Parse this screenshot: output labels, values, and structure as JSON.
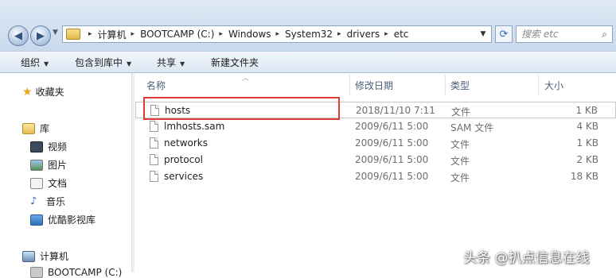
{
  "address": {
    "crumbs": [
      "计算机",
      "BOOTCAMP (C:)",
      "Windows",
      "System32",
      "drivers",
      "etc"
    ]
  },
  "search": {
    "placeholder": "搜索 etc"
  },
  "toolbar": {
    "organize": "组织",
    "include": "包含到库中",
    "share": "共享",
    "new_folder": "新建文件夹"
  },
  "nav": {
    "favorites": "收藏夹",
    "libraries": "库",
    "videos": "视频",
    "pictures": "图片",
    "documents": "文档",
    "music": "音乐",
    "youku": "优酷影视库",
    "computer": "计算机",
    "drive": "BOOTCAMP (C:)"
  },
  "columns": {
    "name": "名称",
    "date": "修改日期",
    "type": "类型",
    "size": "大小"
  },
  "files": [
    {
      "name": "hosts",
      "date": "2018/11/10 7:11",
      "type": "文件",
      "size": "1 KB"
    },
    {
      "name": "lmhosts.sam",
      "date": "2009/6/11 5:00",
      "type": "SAM 文件",
      "size": "4 KB"
    },
    {
      "name": "networks",
      "date": "2009/6/11 5:00",
      "type": "文件",
      "size": "1 KB"
    },
    {
      "name": "protocol",
      "date": "2009/6/11 5:00",
      "type": "文件",
      "size": "2 KB"
    },
    {
      "name": "services",
      "date": "2009/6/11 5:00",
      "type": "文件",
      "size": "18 KB"
    }
  ],
  "watermark": "头条 @扒点信息在线",
  "colors": {
    "highlight": "#e03b3b",
    "accent": "#2d6bb5"
  }
}
